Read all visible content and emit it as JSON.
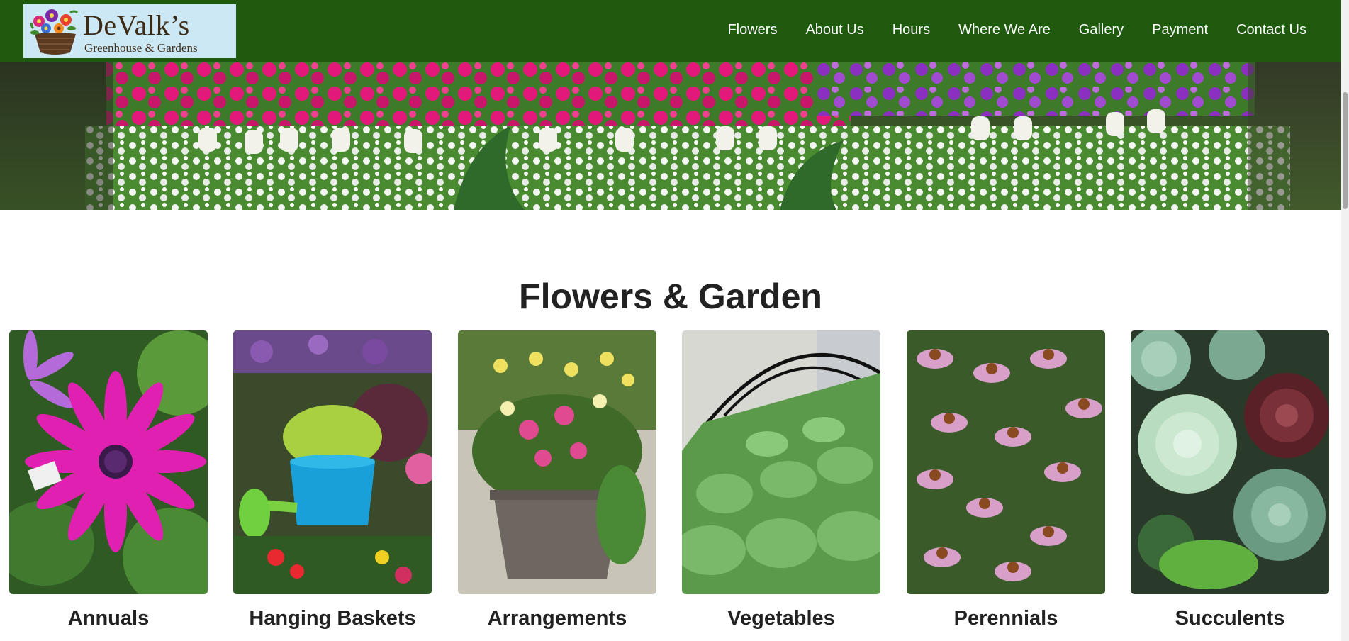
{
  "logo": {
    "name": "DeValk’s",
    "subtitle": "Greenhouse & Gardens"
  },
  "nav": {
    "items": [
      "Flowers",
      "About Us",
      "Hours",
      "Where We Are",
      "Gallery",
      "Payment",
      "Contact Us"
    ]
  },
  "hero": {
    "image": "greenhouse flower beds with pink, purple and white petunias"
  },
  "main": {
    "title": "Flowers & Garden",
    "categories": [
      {
        "label": "Annuals",
        "image": "magenta daisy"
      },
      {
        "label": "Hanging Baskets",
        "image": "blue watering can basket"
      },
      {
        "label": "Arrangements",
        "image": "potted flower arrangement"
      },
      {
        "label": "Vegetables",
        "image": "vegetable seedling rows under hoops"
      },
      {
        "label": "Perennials",
        "image": "pink coneflowers"
      },
      {
        "label": "Succulents",
        "image": "succulent rosettes"
      }
    ]
  },
  "colors": {
    "header_bg": "#1f5a0f",
    "logo_bg": "#cde8f5",
    "nav_text": "#ffffff",
    "heading_text": "#222222"
  }
}
